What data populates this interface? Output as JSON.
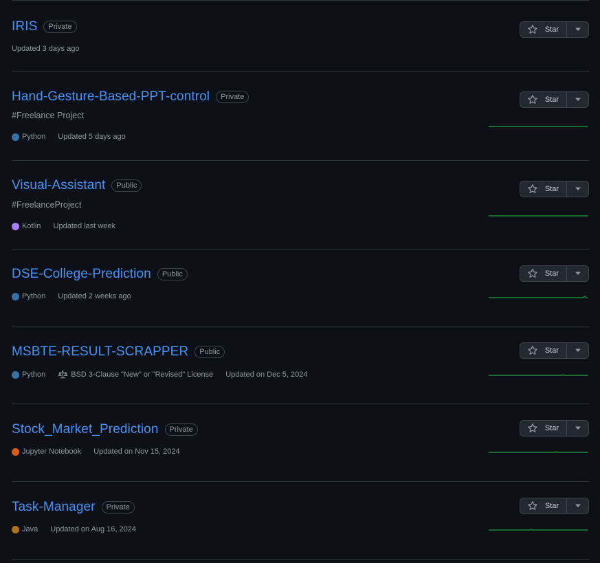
{
  "repos": [
    {
      "name": "IRIS",
      "visibility": "Private",
      "description": "",
      "language": "",
      "license": "",
      "updated": "Updated 3 days ago"
    },
    {
      "name": "Hand-Gesture-Based-PPT-control",
      "visibility": "Private",
      "description": "#Freelance Project",
      "language": "Python",
      "license": "",
      "updated": "Updated 5 days ago"
    },
    {
      "name": "Visual-Assistant",
      "visibility": "Public",
      "description": "#FreelanceProject",
      "language": "Kotlin",
      "license": "",
      "updated": "Updated last week"
    },
    {
      "name": "DSE-College-Prediction",
      "visibility": "Public",
      "description": "",
      "language": "Python",
      "license": "",
      "updated": "Updated 2 weeks ago"
    },
    {
      "name": "MSBTE-RESULT-SCRAPPER",
      "visibility": "Public",
      "description": "",
      "language": "Python",
      "license": "BSD 3-Clause \"New\" or \"Revised\" License",
      "updated": "Updated on Dec 5, 2024"
    },
    {
      "name": "Stock_Market_Prediction",
      "visibility": "Private",
      "description": "",
      "language": "Jupyter Notebook",
      "license": "",
      "updated": "Updated on Nov 15, 2024"
    },
    {
      "name": "Task-Manager",
      "visibility": "Private",
      "description": "",
      "language": "Java",
      "license": "",
      "updated": "Updated on Aug 16, 2024"
    }
  ],
  "star_label": "Star",
  "language_colors": {
    "Python": "#3572A5",
    "Kotlin": "#A97BFF",
    "Jupyter Notebook": "#DA5B0B",
    "Java": "#b07219"
  },
  "icons": {
    "star": "star-icon",
    "caret": "triangle-down-icon",
    "license": "law-icon"
  },
  "colors": {
    "background": "#0d1117",
    "link": "#4493f8",
    "muted": "#9198a1",
    "border": "#30363d",
    "sparkline": "#196c2e"
  }
}
